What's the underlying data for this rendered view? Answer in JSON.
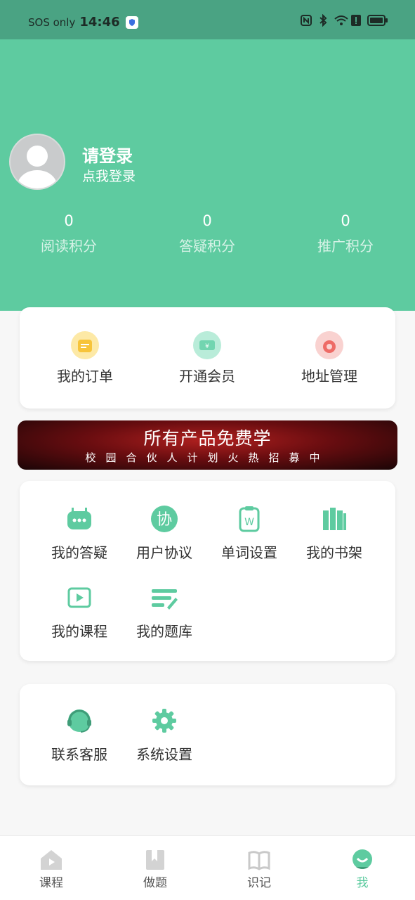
{
  "status_bar": {
    "carrier": "SOS only",
    "time": "14:46"
  },
  "profile": {
    "title": "请登录",
    "subtitle": "点我登录"
  },
  "stats": [
    {
      "value": "0",
      "label": "阅读积分"
    },
    {
      "value": "0",
      "label": "答疑积分"
    },
    {
      "value": "0",
      "label": "推广积分"
    }
  ],
  "quick_actions": [
    {
      "label": "我的订单",
      "icon": "order-icon"
    },
    {
      "label": "开通会员",
      "icon": "vip-icon"
    },
    {
      "label": "地址管理",
      "icon": "location-icon"
    }
  ],
  "banner": {
    "title": "所有产品免费学",
    "subtitle": "校园合伙人计划火热招募中"
  },
  "features": [
    {
      "label": "我的答疑",
      "icon": "robot-icon"
    },
    {
      "label": "用户协议",
      "icon": "agreement-icon"
    },
    {
      "label": "单词设置",
      "icon": "word-settings-icon"
    },
    {
      "label": "我的书架",
      "icon": "bookshelf-icon"
    },
    {
      "label": "我的课程",
      "icon": "play-icon"
    },
    {
      "label": "我的题库",
      "icon": "question-bank-icon"
    }
  ],
  "support": [
    {
      "label": "联系客服",
      "icon": "headset-icon"
    },
    {
      "label": "系统设置",
      "icon": "gear-icon"
    }
  ],
  "tabs": [
    {
      "label": "课程",
      "icon": "home-icon",
      "active": false
    },
    {
      "label": "做题",
      "icon": "bookmark-icon",
      "active": false
    },
    {
      "label": "识记",
      "icon": "book-icon",
      "active": false
    },
    {
      "label": "我",
      "icon": "user-icon",
      "active": true
    }
  ],
  "colors": {
    "accent": "#5ecba0",
    "status_bar": "#4aa383",
    "banner": "#8a1416"
  }
}
